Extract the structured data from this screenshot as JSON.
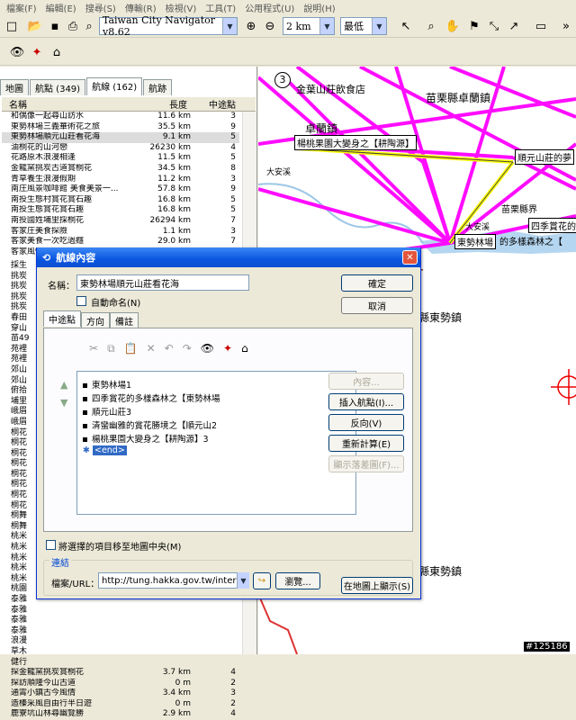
{
  "menu": [
    "檔案(F)",
    "編輯(E)",
    "搜尋(S)",
    "傳輸(R)",
    "檢視(V)",
    "工具(T)",
    "公用程式(U)",
    "說明(H)"
  ],
  "toolbar": {
    "product_combo": "Taiwan City Navigator v8.62",
    "zoom_combo": "2 km",
    "detail_combo": "最低"
  },
  "left": {
    "tabs": [
      "地圖",
      "航點 (349)",
      "航線 (162)",
      "航跡"
    ],
    "columns": {
      "name": "名稱",
      "length": "長度",
      "via": "中途點"
    },
    "rows": [
      {
        "n": "和偶像一起尋山訪水",
        "l": "11.6 km",
        "c": "3"
      },
      {
        "n": "東勢林場三義華術花之旅",
        "l": "35.5 km",
        "c": "9"
      },
      {
        "n": "東勢林場順元山莊看花海",
        "l": "9.1 km",
        "c": "5"
      },
      {
        "n": "油桐花的山河戀",
        "l": "26230 km",
        "c": "4"
      },
      {
        "n": "花路原木浪漫相逢",
        "l": "11.5 km",
        "c": "5"
      },
      {
        "n": "金龍窯挑炭古道賞桐花",
        "l": "34.5 km",
        "c": "8"
      },
      {
        "n": "青草養生浪漫假期",
        "l": "11.2 km",
        "c": "3"
      },
      {
        "n": "南庄風景咖啡館 美食美景一...",
        "l": "57.8 km",
        "c": "9"
      },
      {
        "n": "南投生態村賞花賞石趣",
        "l": "16.8 km",
        "c": "5"
      },
      {
        "n": "南投生態賞花賞石趣",
        "l": "16.8 km",
        "c": "5"
      },
      {
        "n": "南投國姓埔里採桐花",
        "l": "26294 km",
        "c": "7"
      },
      {
        "n": "客家庄美食探險",
        "l": "1.1 km",
        "c": "3"
      },
      {
        "n": "客家美食一次吃過癮",
        "l": "29.0 km",
        "c": "7"
      },
      {
        "n": "客家風情懷舊之旅",
        "l": "19.0 km",
        "c": "9"
      }
    ],
    "bottom_rows": [
      {
        "n": "探金龍窯挑炭賞桐花",
        "l": "3.7 km",
        "c": "4"
      },
      {
        "n": "探訪順隆今山古道",
        "l": "0 m",
        "c": "2"
      },
      {
        "n": "通霄小鎮古今風情",
        "l": "3.4 km",
        "c": "3"
      },
      {
        "n": "造榛采風自由行半日遊",
        "l": "0 m",
        "c": "2"
      },
      {
        "n": "鹿寮坑山林尋幽覽勝",
        "l": "2.9 km",
        "c": "4"
      }
    ],
    "hidden_rows": [
      "採生",
      "挑炭",
      "挑炭",
      "挑炭",
      "挑炭",
      "春田",
      "穿山",
      "苗49",
      "苑裡",
      "苑裡",
      "郊山",
      "郊山",
      "俯拾",
      "埔里",
      "峨眉",
      "峨眉",
      "桐花",
      "桐花",
      "桐花",
      "桐花",
      "桐花",
      "桐花",
      "桐花",
      "桐花",
      "桐舞",
      "桐舞",
      "桃米",
      "桃米",
      "桃米",
      "桃米",
      "桃米",
      "桃園",
      "泰雅",
      "泰雅",
      "泰雅",
      "泰雅",
      "浪漫",
      "草木",
      "健行"
    ]
  },
  "map": {
    "labels": {
      "restaurant": "金葉山莊飲食店",
      "township1": "苗栗縣卓蘭鎮",
      "town": "卓蘭鎮",
      "wp_change": "楊桃果園大變身之【耕陶源】",
      "wp_shunyuan": "順元山莊的夢",
      "daan1": "大安溪",
      "border": "苗栗縣界",
      "daan2": "大安溪",
      "wp_forest": "四季賞花的多",
      "wp_farm": "東勢林場",
      "wp_farm2": "的多樣森林之【",
      "township2": "台中縣東勢鎮",
      "township3": "台中縣東勢鎮",
      "badge3": "3"
    },
    "watermark": "#125186"
  },
  "dialog": {
    "title": "航線內容",
    "name_label": "名稱：",
    "name_value": "東勢林場順元山莊看花海",
    "auto_name": "自動命名(N)",
    "ok": "確定",
    "cancel": "取消",
    "tabs": [
      "中途點",
      "方向",
      "備註"
    ],
    "waypoints": [
      "東勢林場1",
      "四季賞花的多樣森林之【東勢林場",
      "順元山莊3",
      "清蠻幽雅的賞花勝境之【順元山2",
      "楊桃果園大變身之【耕陶源】3"
    ],
    "end_item": "<end>",
    "btn_props": "內容...",
    "btn_insert": "插入航點(I)...",
    "btn_reverse": "反向(V)",
    "btn_recalc": "重新計算(E)",
    "btn_show_dropdown": "顯示落差圖(F)...",
    "center_check": "將選擇的項目移至地圖中央(M)",
    "link_group": "連結",
    "url_label": "檔案/URL：",
    "url_value": "http://tung.hakka.gov.tw/internet/en/",
    "browse": "瀏覽...",
    "show_on_map": "在地圖上顯示(S)"
  }
}
